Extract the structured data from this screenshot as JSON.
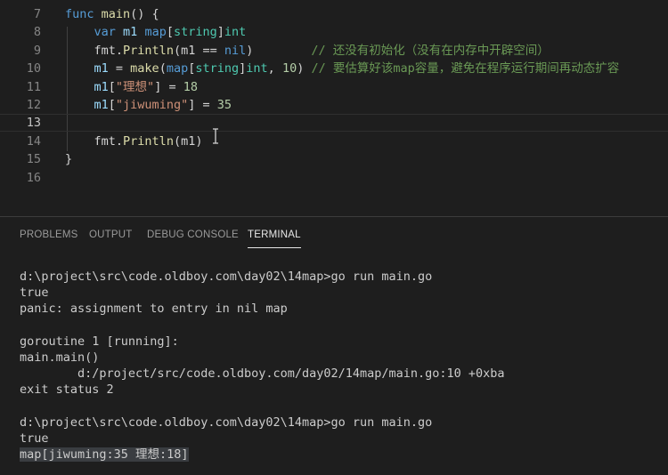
{
  "editor": {
    "lines": [
      {
        "n": "7",
        "tokens": [
          {
            "t": "func",
            "c": "kw"
          },
          {
            "t": " ",
            "c": "pl"
          },
          {
            "t": "main",
            "c": "fn"
          },
          {
            "t": "() {",
            "c": "pl"
          }
        ]
      },
      {
        "n": "8",
        "tokens": [
          {
            "t": "    ",
            "c": "pl"
          },
          {
            "t": "var",
            "c": "kw"
          },
          {
            "t": " ",
            "c": "pl"
          },
          {
            "t": "m1",
            "c": "var"
          },
          {
            "t": " ",
            "c": "pl"
          },
          {
            "t": "map",
            "c": "kw"
          },
          {
            "t": "[",
            "c": "pl"
          },
          {
            "t": "string",
            "c": "ty"
          },
          {
            "t": "]",
            "c": "pl"
          },
          {
            "t": "int",
            "c": "ty"
          }
        ]
      },
      {
        "n": "9",
        "tokens": [
          {
            "t": "    ",
            "c": "pl"
          },
          {
            "t": "fmt",
            "c": "pl"
          },
          {
            "t": ".",
            "c": "pl"
          },
          {
            "t": "Println",
            "c": "fn"
          },
          {
            "t": "(m1 == ",
            "c": "pl"
          },
          {
            "t": "nil",
            "c": "kw"
          },
          {
            "t": ")        ",
            "c": "pl"
          },
          {
            "t": "// 还没有初始化（没有在内存中开辟空间）",
            "c": "cm"
          }
        ]
      },
      {
        "n": "10",
        "tokens": [
          {
            "t": "    ",
            "c": "pl"
          },
          {
            "t": "m1",
            "c": "var"
          },
          {
            "t": " = ",
            "c": "pl"
          },
          {
            "t": "make",
            "c": "fn"
          },
          {
            "t": "(",
            "c": "pl"
          },
          {
            "t": "map",
            "c": "kw"
          },
          {
            "t": "[",
            "c": "pl"
          },
          {
            "t": "string",
            "c": "ty"
          },
          {
            "t": "]",
            "c": "pl"
          },
          {
            "t": "int",
            "c": "ty"
          },
          {
            "t": ", ",
            "c": "pl"
          },
          {
            "t": "10",
            "c": "num"
          },
          {
            "t": ") ",
            "c": "pl"
          },
          {
            "t": "// 要估算好该map容量，避免在程序运行期间再动态扩容",
            "c": "cm"
          }
        ]
      },
      {
        "n": "11",
        "tokens": [
          {
            "t": "    ",
            "c": "pl"
          },
          {
            "t": "m1",
            "c": "var"
          },
          {
            "t": "[",
            "c": "pl"
          },
          {
            "t": "\"理想\"",
            "c": "str"
          },
          {
            "t": "] = ",
            "c": "pl"
          },
          {
            "t": "18",
            "c": "num"
          }
        ]
      },
      {
        "n": "12",
        "tokens": [
          {
            "t": "    ",
            "c": "pl"
          },
          {
            "t": "m1",
            "c": "var"
          },
          {
            "t": "[",
            "c": "pl"
          },
          {
            "t": "\"jiwuming\"",
            "c": "str"
          },
          {
            "t": "] = ",
            "c": "pl"
          },
          {
            "t": "35",
            "c": "num"
          }
        ]
      },
      {
        "n": "13",
        "tokens": []
      },
      {
        "n": "14",
        "tokens": [
          {
            "t": "    ",
            "c": "pl"
          },
          {
            "t": "fmt",
            "c": "pl"
          },
          {
            "t": ".",
            "c": "pl"
          },
          {
            "t": "Println",
            "c": "fn"
          },
          {
            "t": "(m1)",
            "c": "pl"
          }
        ]
      },
      {
        "n": "15",
        "tokens": [
          {
            "t": "}",
            "c": "pl"
          }
        ]
      },
      {
        "n": "16",
        "tokens": []
      }
    ],
    "current_line": "13"
  },
  "panel": {
    "tabs": [
      {
        "label": "PROBLEMS",
        "active": false
      },
      {
        "label": "OUTPUT",
        "active": false
      },
      {
        "label": "DEBUG CONSOLE",
        "active": false
      },
      {
        "label": "TERMINAL",
        "active": true
      }
    ],
    "terminal_lines": [
      "d:\\project\\src\\code.oldboy.com\\day02\\14map>go run main.go",
      "true",
      "panic: assignment to entry in nil map",
      "",
      "goroutine 1 [running]:",
      "main.main()",
      "        d:/project/src/code.oldboy.com/day02/14map/main.go:10 +0xba",
      "exit status 2",
      "",
      "d:\\project\\src\\code.oldboy.com\\day02\\14map>go run main.go",
      "true",
      "map[jiwuming:35 理想:18]"
    ]
  }
}
